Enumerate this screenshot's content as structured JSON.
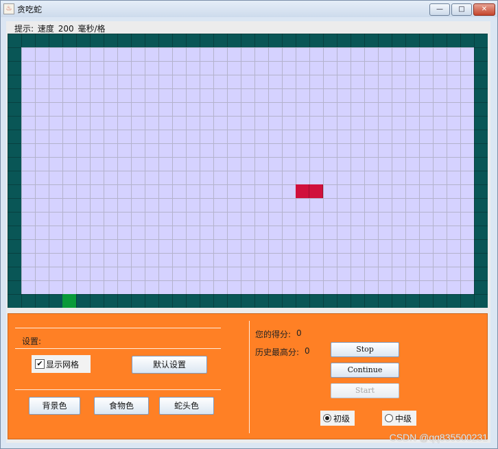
{
  "window": {
    "title": "贪吃蛇",
    "app_icon": "java-cup-icon",
    "buttons": {
      "minimize": "—",
      "maximize": "□",
      "close": "✕"
    }
  },
  "hint": {
    "prefix": "提示:",
    "speed_label": "速度",
    "speed_value": "200",
    "unit": "毫秒/格"
  },
  "board": {
    "columns": 35,
    "rows": 20,
    "colors": {
      "wall": "#095656",
      "background": "#d5d2ff",
      "grid": "#b3b2cc",
      "snake": "#d0103b",
      "food": "#0a9a3a"
    },
    "snake": [
      {
        "col": 20,
        "row": 10
      },
      {
        "col": 21,
        "row": 10
      }
    ],
    "food": {
      "col": 3,
      "row": 18
    }
  },
  "settings": {
    "title": "设置:",
    "show_grid": {
      "label": "显示网格",
      "checked": true,
      "mark": "✔"
    },
    "default_button": "默认设置",
    "color_buttons": {
      "background": "背景色",
      "food": "食物色",
      "snake_head": "蛇头色"
    }
  },
  "score": {
    "current_label": "您的得分:",
    "current_value": "0",
    "best_label": "历史最高分:",
    "best_value": "0"
  },
  "controls": {
    "stop": "Stop",
    "continue": "Continue",
    "start": "Start"
  },
  "levels": [
    {
      "label": "初级",
      "selected": true
    },
    {
      "label": "中级",
      "selected": false
    }
  ],
  "watermark": "CSDN @qq835500231"
}
